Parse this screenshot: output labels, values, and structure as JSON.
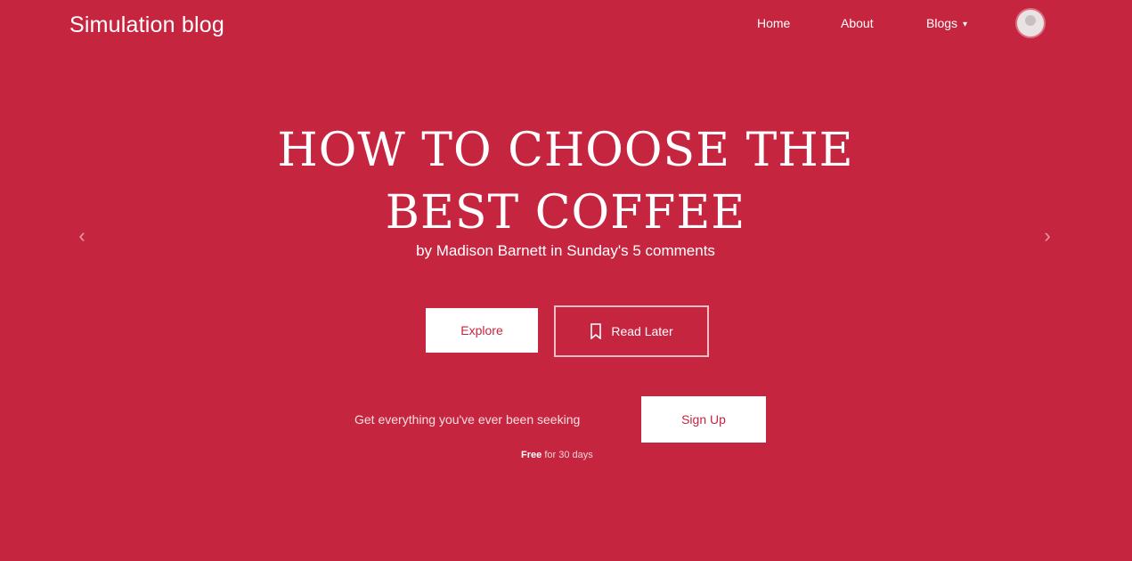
{
  "header": {
    "brand": "Simulation blog",
    "nav": [
      {
        "label": "Home"
      },
      {
        "label": "About"
      },
      {
        "label": "Blogs"
      }
    ],
    "avatar_icon": "user-avatar-icon"
  },
  "hero": {
    "title": "HOW TO CHOOSE THE BEST COFFEE",
    "byline": "by Madison Barnett in Sunday's 5 comments",
    "primary_button": "Explore",
    "secondary_button": "Read Later",
    "prev_icon": "chevron-left-icon",
    "next_icon": "chevron-right-icon"
  },
  "subscribe": {
    "text": "Get everything you've ever been seeking",
    "button": "Sign Up",
    "note_bold": "Free",
    "note_rest": "for 30 days"
  },
  "colors": {
    "background": "#c6253f",
    "text": "#ffffff"
  }
}
